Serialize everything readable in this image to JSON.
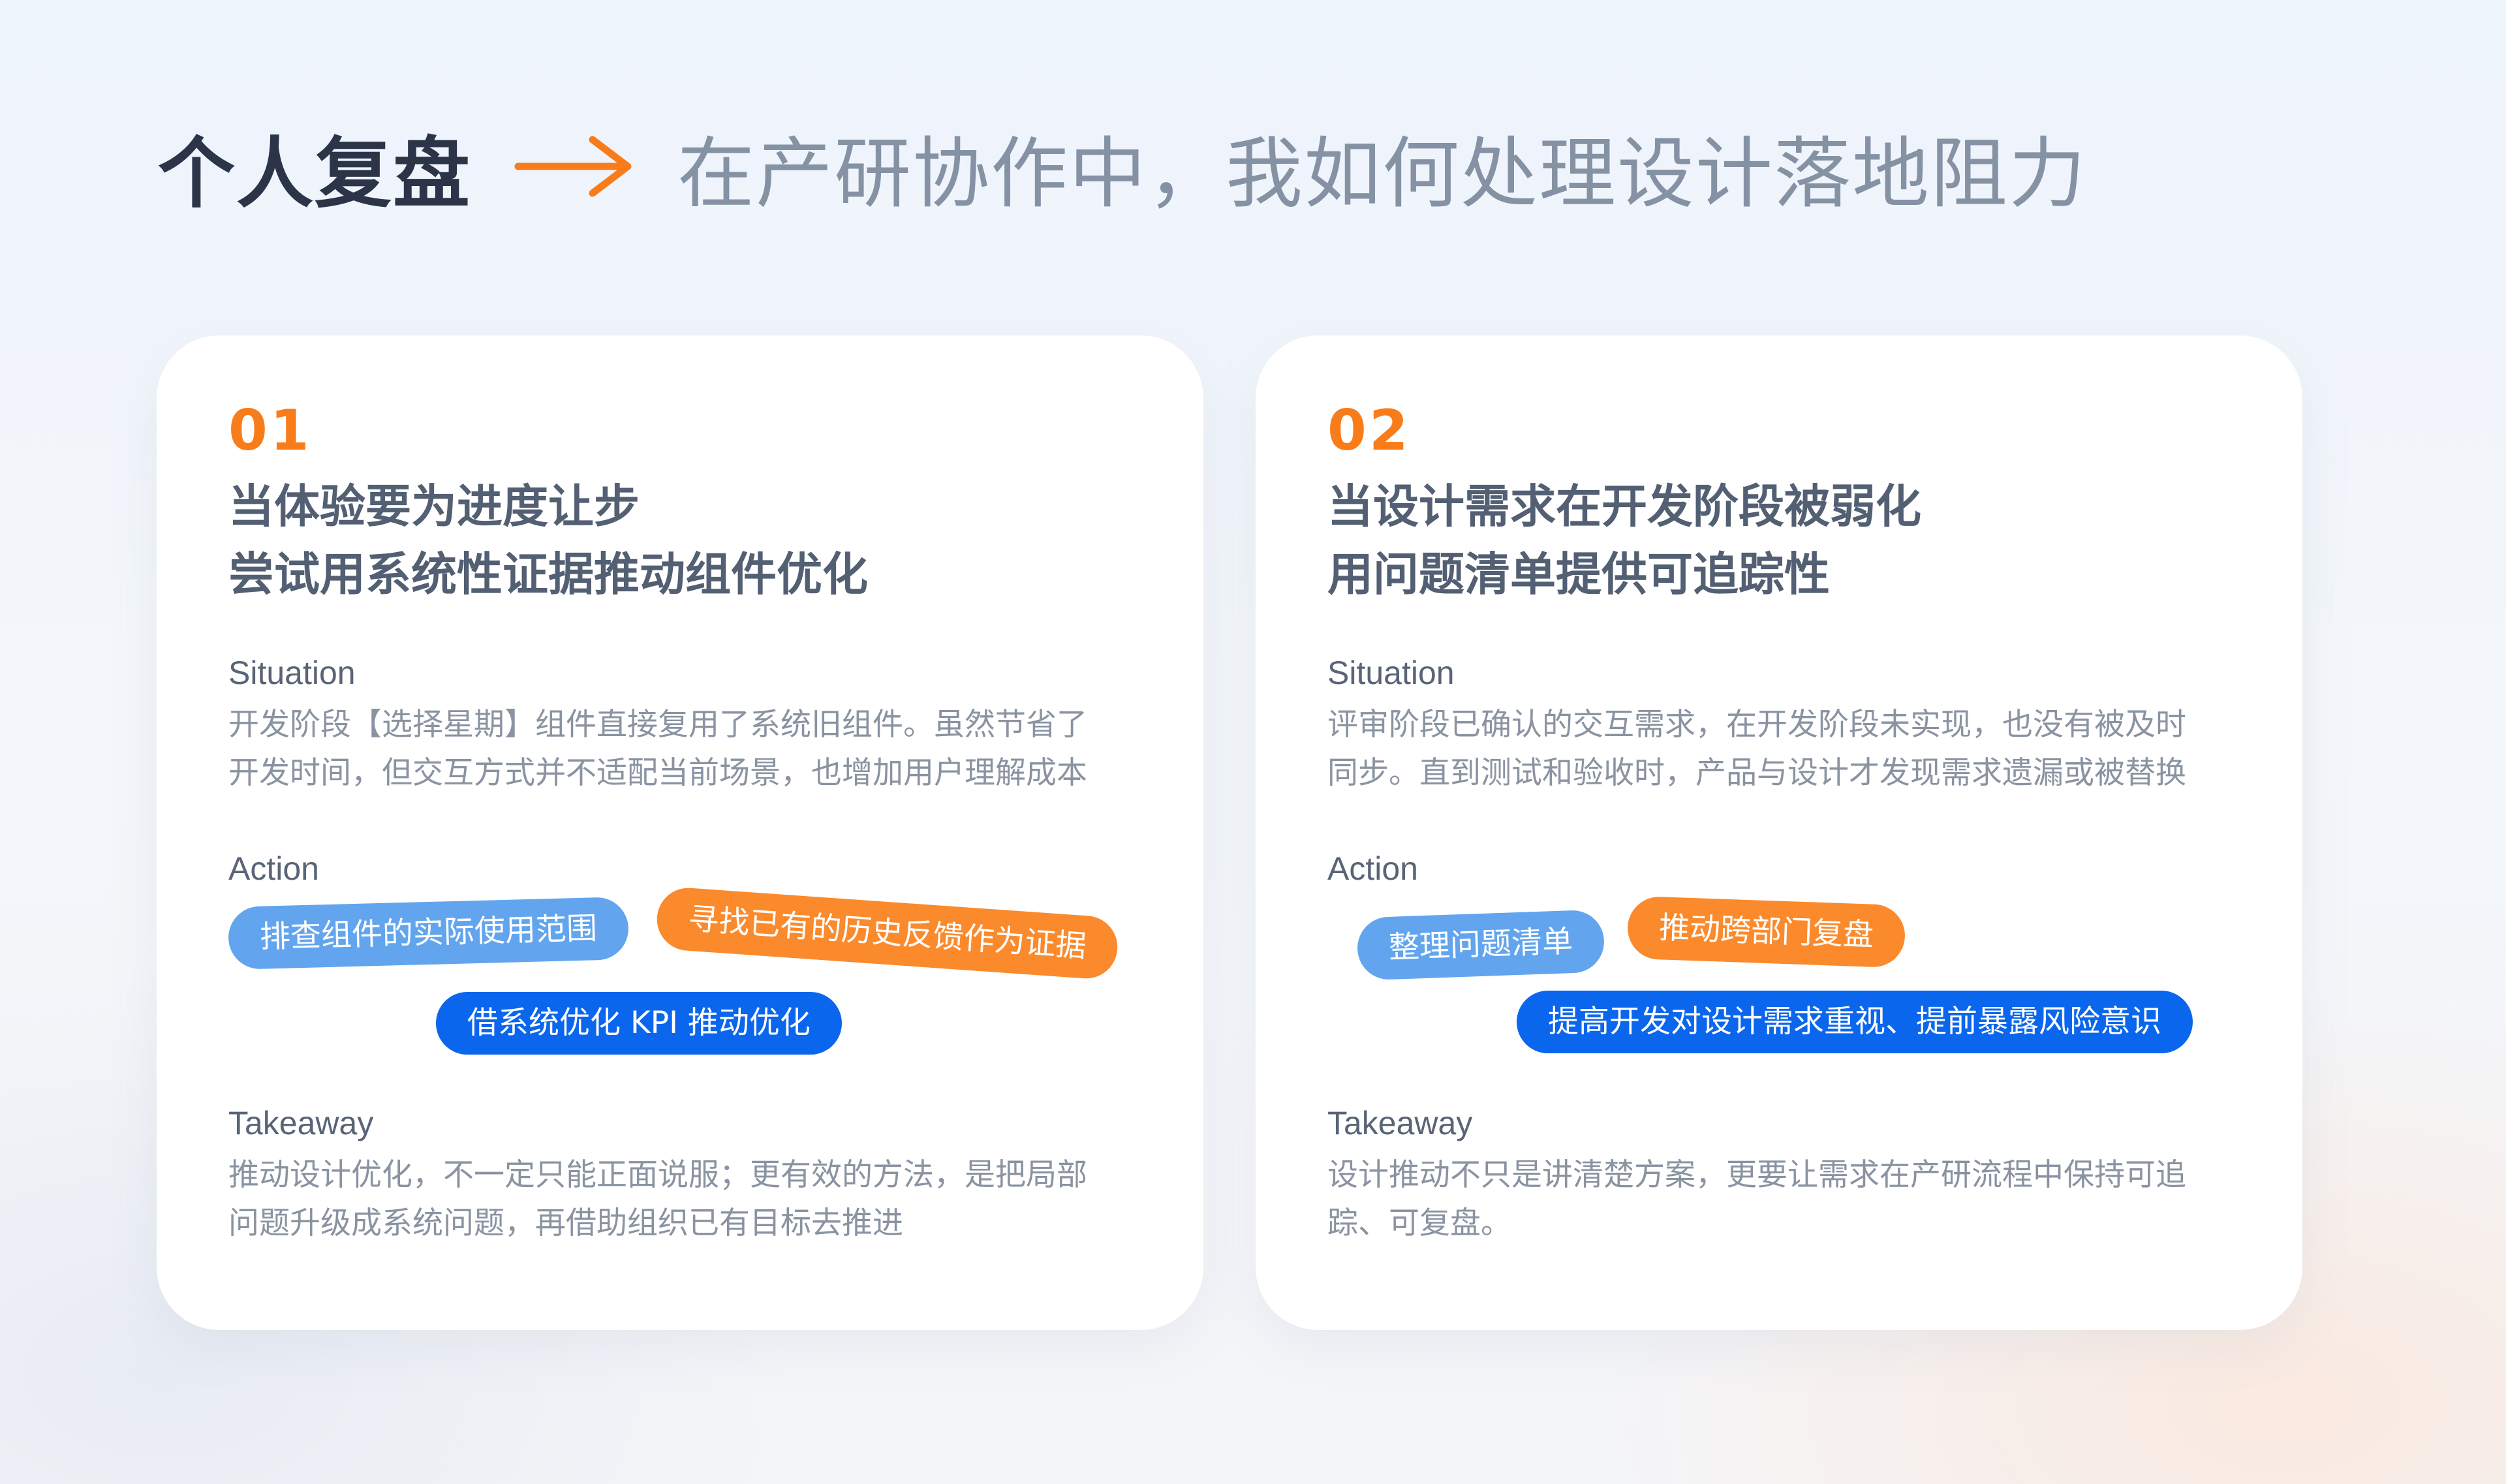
{
  "header": {
    "title": "个人复盘",
    "subtitle": "在产研协作中，我如何处理设计落地阻力"
  },
  "colors": {
    "accent_orange": "#f97c1a",
    "pill_light_blue": "#62a5ee",
    "pill_orange": "#fb8a2c",
    "pill_blue": "#0b66ee"
  },
  "cards": [
    {
      "number": "01",
      "heading_lines": [
        "当体验要为进度让步",
        "尝试用系统性证据推动组件优化"
      ],
      "situation_label": "Situation",
      "situation_lines": [
        "开发阶段【选择星期】组件直接复用了系统旧组件。虽然节省了",
        "开发时间，但交互方式并不适配当前场景，也增加用户理解成本"
      ],
      "action_label": "Action",
      "actions": [
        "排查组件的实际使用范围",
        "寻找已有的历史反馈作为证据",
        "借系统优化 KPI 推动优化"
      ],
      "takeaway_label": "Takeaway",
      "takeaway_lines": [
        "推动设计优化，不一定只能正面说服；更有效的方法，是把局部",
        "问题升级成系统问题，再借助组织已有目标去推进"
      ]
    },
    {
      "number": "02",
      "heading_lines": [
        "当设计需求在开发阶段被弱化",
        "用问题清单提供可追踪性"
      ],
      "situation_label": "Situation",
      "situation_lines": [
        "评审阶段已确认的交互需求，在开发阶段未实现，也没有被及时",
        "同步。直到测试和验收时，产品与设计才发现需求遗漏或被替换"
      ],
      "action_label": "Action",
      "actions": [
        "整理问题清单",
        "推动跨部门复盘",
        "提高开发对设计需求重视、提前暴露风险意识"
      ],
      "takeaway_label": "Takeaway",
      "takeaway_lines": [
        "设计推动不只是讲清楚方案，更要让需求在产研流程中保持可追",
        "踪、可复盘。"
      ]
    }
  ]
}
